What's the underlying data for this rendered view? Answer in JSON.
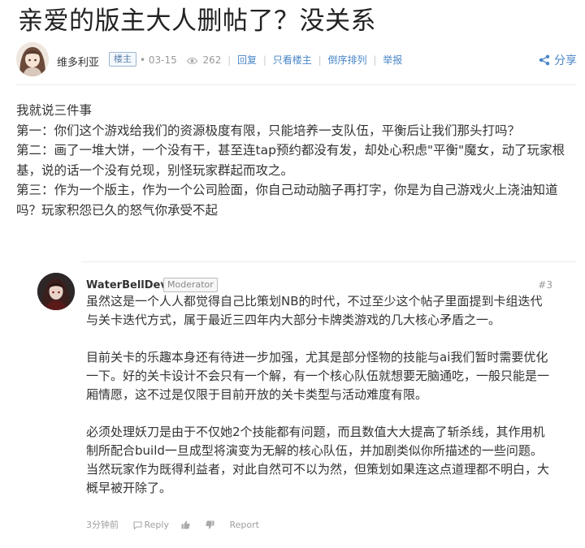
{
  "post": {
    "title": "亲爱的版主大人删帖了？没关系",
    "author": "维多利亚",
    "role_badge": "楼主",
    "date": "03-15",
    "views": "262",
    "actions": [
      "回复",
      "只看楼主",
      "倒序排列",
      "举报"
    ],
    "share_label": "分享",
    "body": [
      "我就说三件事",
      "第一：你们这个游戏给我们的资源极度有限，只能培养一支队伍，平衡后让我们那头打吗？",
      "第二：画了一堆大饼，一个没有干，甚至连tap预约都没有发，却处心积虑\"平衡\"魔女，动了玩家根基，说的话一个没有兑现，别怪玩家群起而攻之。",
      "第三：作为一个版主，作为一个公司脸面，你自己动动脑子再打字，你是为自己游戏火上浇油知道吗？玩家积怨已久的怒气你承受不起"
    ]
  },
  "reply": {
    "author": "WaterBellDev",
    "badge": "Moderator",
    "floor": "#3",
    "paragraphs": [
      "虽然这是一个人人都觉得自己比策划NB的时代，不过至少这个帖子里面提到卡组迭代与关卡迭代方式，属于最近三四年内大部分卡牌类游戏的几大核心矛盾之一。",
      "目前关卡的乐趣本身还有待进一步加强，尤其是部分怪物的技能与ai我们暂时需要优化一下。好的关卡设计不会只有一个解，有一个核心队伍就想要无脑通吃，一般只能是一厢情愿，这不过是仅限于目前开放的关卡类型与活动难度有限。",
      "必须处理妖刀是由于不仅她2个技能都有问题，而且数值大大提高了斩杀线，其作用机制所配合build一旦成型将演变为无解的核心队伍，并加剧类似你所描述的一些问题。当然玩家作为既得利益者，对此自然可不以为然，但策划如果连这点道理都不明白，大概早被开除了。"
    ],
    "time": "3分钟前",
    "reply_label": "Reply",
    "report_label": "Report"
  },
  "colors": {
    "link": "#4a86c8",
    "muted": "#999999",
    "text": "#333333"
  },
  "icons": [
    "eye-icon",
    "share-icon",
    "reply-icon",
    "thumbs-up-icon",
    "thumbs-down-icon"
  ]
}
